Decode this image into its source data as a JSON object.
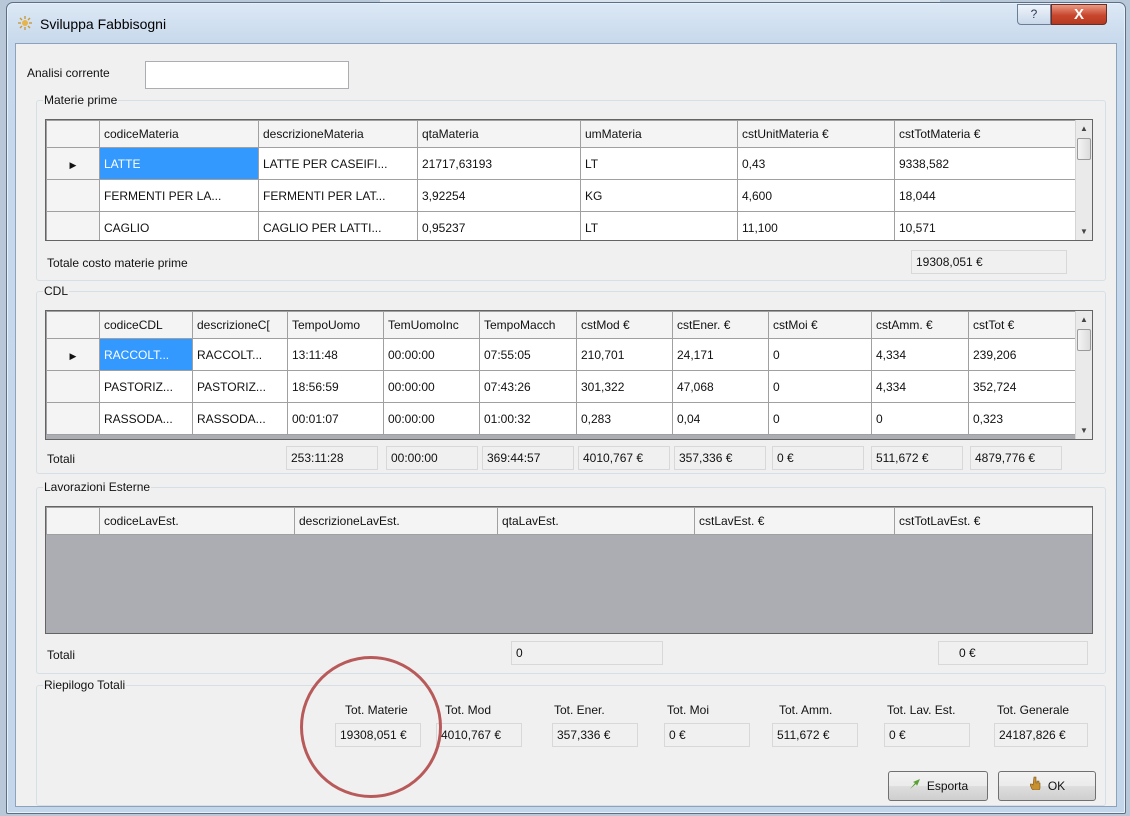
{
  "window": {
    "title": "Sviluppa Fabbisogni",
    "help_label": "?",
    "close_label": "X"
  },
  "analisi": {
    "label": "Analisi corrente",
    "value": ""
  },
  "materie": {
    "legend": "Materie prime",
    "columns": [
      "codiceMateria",
      "descrizioneMateria",
      "qtaMateria",
      "umMateria",
      "cstUnitMateria €",
      "cstTotMateria €"
    ],
    "rows": [
      [
        "LATTE",
        "LATTE PER CASEIFI...",
        "21717,63193",
        "LT",
        "0,43",
        "9338,582"
      ],
      [
        "FERMENTI PER LA...",
        "FERMENTI PER LAT...",
        "3,92254",
        "KG",
        "4,600",
        "18,044"
      ],
      [
        "CAGLIO",
        "CAGLIO PER LATTI...",
        "0,95237",
        "LT",
        "11,100",
        "10,571"
      ]
    ],
    "total_label": "Totale costo materie prime",
    "total_value": "19308,051 €"
  },
  "cdl": {
    "legend": "CDL",
    "columns": [
      "codiceCDL",
      "descrizioneC[",
      "TempoUomo",
      "TemUomoInc",
      "TempoMacch",
      "cstMod €",
      "cstEner. €",
      "cstMoi €",
      "cstAmm. €",
      "cstTot €"
    ],
    "rows": [
      [
        "RACCOLT...",
        "RACCOLT...",
        "13:11:48",
        "00:00:00",
        "07:55:05",
        "210,701",
        "24,171",
        "0",
        "4,334",
        "239,206"
      ],
      [
        "PASTORIZ...",
        "PASTORIZ...",
        "18:56:59",
        "00:00:00",
        "07:43:26",
        "301,322",
        "47,068",
        "0",
        "4,334",
        "352,724"
      ],
      [
        "RASSODA...",
        "RASSODA...",
        "00:01:07",
        "00:00:00",
        "01:00:32",
        "0,283",
        "0,04",
        "0",
        "0",
        "0,323"
      ]
    ],
    "totals_label": "Totali",
    "totals": [
      "253:11:28",
      "00:00:00",
      "369:44:57",
      "4010,767 €",
      "357,336 €",
      "0 €",
      "511,672 €",
      "4879,776 €"
    ]
  },
  "lavorazioni": {
    "legend": "Lavorazioni Esterne",
    "columns": [
      "codiceLavEst.",
      "descrizioneLavEst.",
      "qtaLavEst.",
      "cstLavEst. €",
      "cstTotLavEst. €"
    ],
    "totals_label": "Totali",
    "total_qta": "0",
    "total_cst": "0 €"
  },
  "riepilogo": {
    "legend": "Riepilogo Totali",
    "items": [
      {
        "label": "Tot. Materie",
        "value": "19308,051 €"
      },
      {
        "label": "Tot. Mod",
        "value": "4010,767 €"
      },
      {
        "label": "Tot. Ener.",
        "value": "357,336 €"
      },
      {
        "label": "Tot. Moi",
        "value": "0 €"
      },
      {
        "label": "Tot. Amm.",
        "value": "511,672 €"
      },
      {
        "label": "Tot. Lav. Est.",
        "value": "0 €"
      },
      {
        "label": "Tot. Generale",
        "value": "24187,826 €"
      }
    ]
  },
  "buttons": {
    "esporta": "Esporta",
    "ok": "OK"
  },
  "colors": {
    "selection": "#3399ff",
    "highlight_circle": "#b85a5a",
    "close_button": "#c8462c"
  }
}
